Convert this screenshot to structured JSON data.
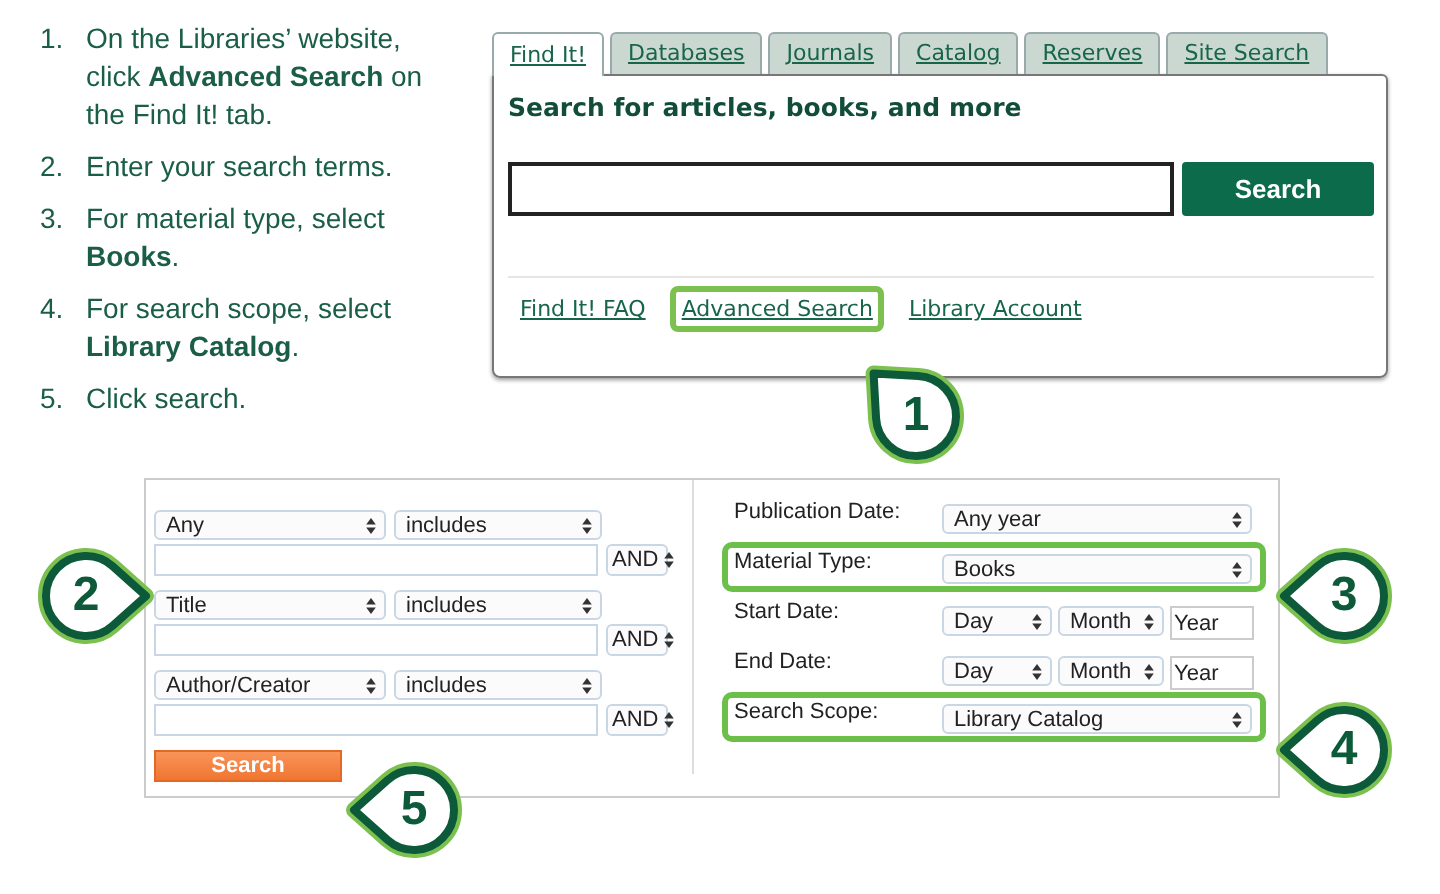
{
  "steps": [
    {
      "number": "1.",
      "text": "On the Libraries’ website, click **Advanced Search** on the Find It! tab."
    },
    {
      "number": "2.",
      "text": "Enter your search terms."
    },
    {
      "number": "3.",
      "text": "For material type, select **Books**."
    },
    {
      "number": "4.",
      "text": "For search scope, select **Library Catalog**."
    },
    {
      "number": "5.",
      "text": "Click search."
    }
  ],
  "basic_search": {
    "tabs": [
      {
        "label": "Find It!",
        "selected": true
      },
      {
        "label": "Databases",
        "selected": false
      },
      {
        "label": "Journals",
        "selected": false
      },
      {
        "label": "Catalog",
        "selected": false
      },
      {
        "label": "Reserves",
        "selected": false
      },
      {
        "label": "Site Search",
        "selected": false
      }
    ],
    "heading": "Search for articles, books, and more",
    "search_button": "Search",
    "links": [
      {
        "label": "Find It! FAQ",
        "highlighted": false
      },
      {
        "label": "Advanced Search",
        "highlighted": true
      },
      {
        "label": "Library Account",
        "highlighted": false
      }
    ]
  },
  "advanced_search": {
    "query_rows": [
      {
        "field": "Any",
        "operator": "includes",
        "boolean": "AND"
      },
      {
        "field": "Title",
        "operator": "includes",
        "boolean": "AND"
      },
      {
        "field": "Author/Creator",
        "operator": "includes",
        "boolean": "AND"
      }
    ],
    "search_button": "Search",
    "filters": [
      {
        "kind": "select",
        "label": "Publication Date:",
        "value": "Any year",
        "highlighted": false
      },
      {
        "kind": "select",
        "label": "Material Type:",
        "value": "Books",
        "highlighted": true
      },
      {
        "kind": "date",
        "label": "Start Date:",
        "day": "Day",
        "month": "Month",
        "placeholder": "Year",
        "highlighted": false
      },
      {
        "kind": "date",
        "label": "End Date:",
        "day": "Day",
        "month": "Month",
        "placeholder": "Year",
        "highlighted": false
      },
      {
        "kind": "select",
        "label": "Search Scope:",
        "value": "Library Catalog",
        "highlighted": true
      }
    ]
  },
  "callouts": [
    {
      "number": "1",
      "kind": "up-left"
    },
    {
      "number": "2",
      "kind": "right"
    },
    {
      "number": "3",
      "kind": "left"
    },
    {
      "number": "4",
      "kind": "left"
    },
    {
      "number": "5",
      "kind": "left"
    }
  ]
}
